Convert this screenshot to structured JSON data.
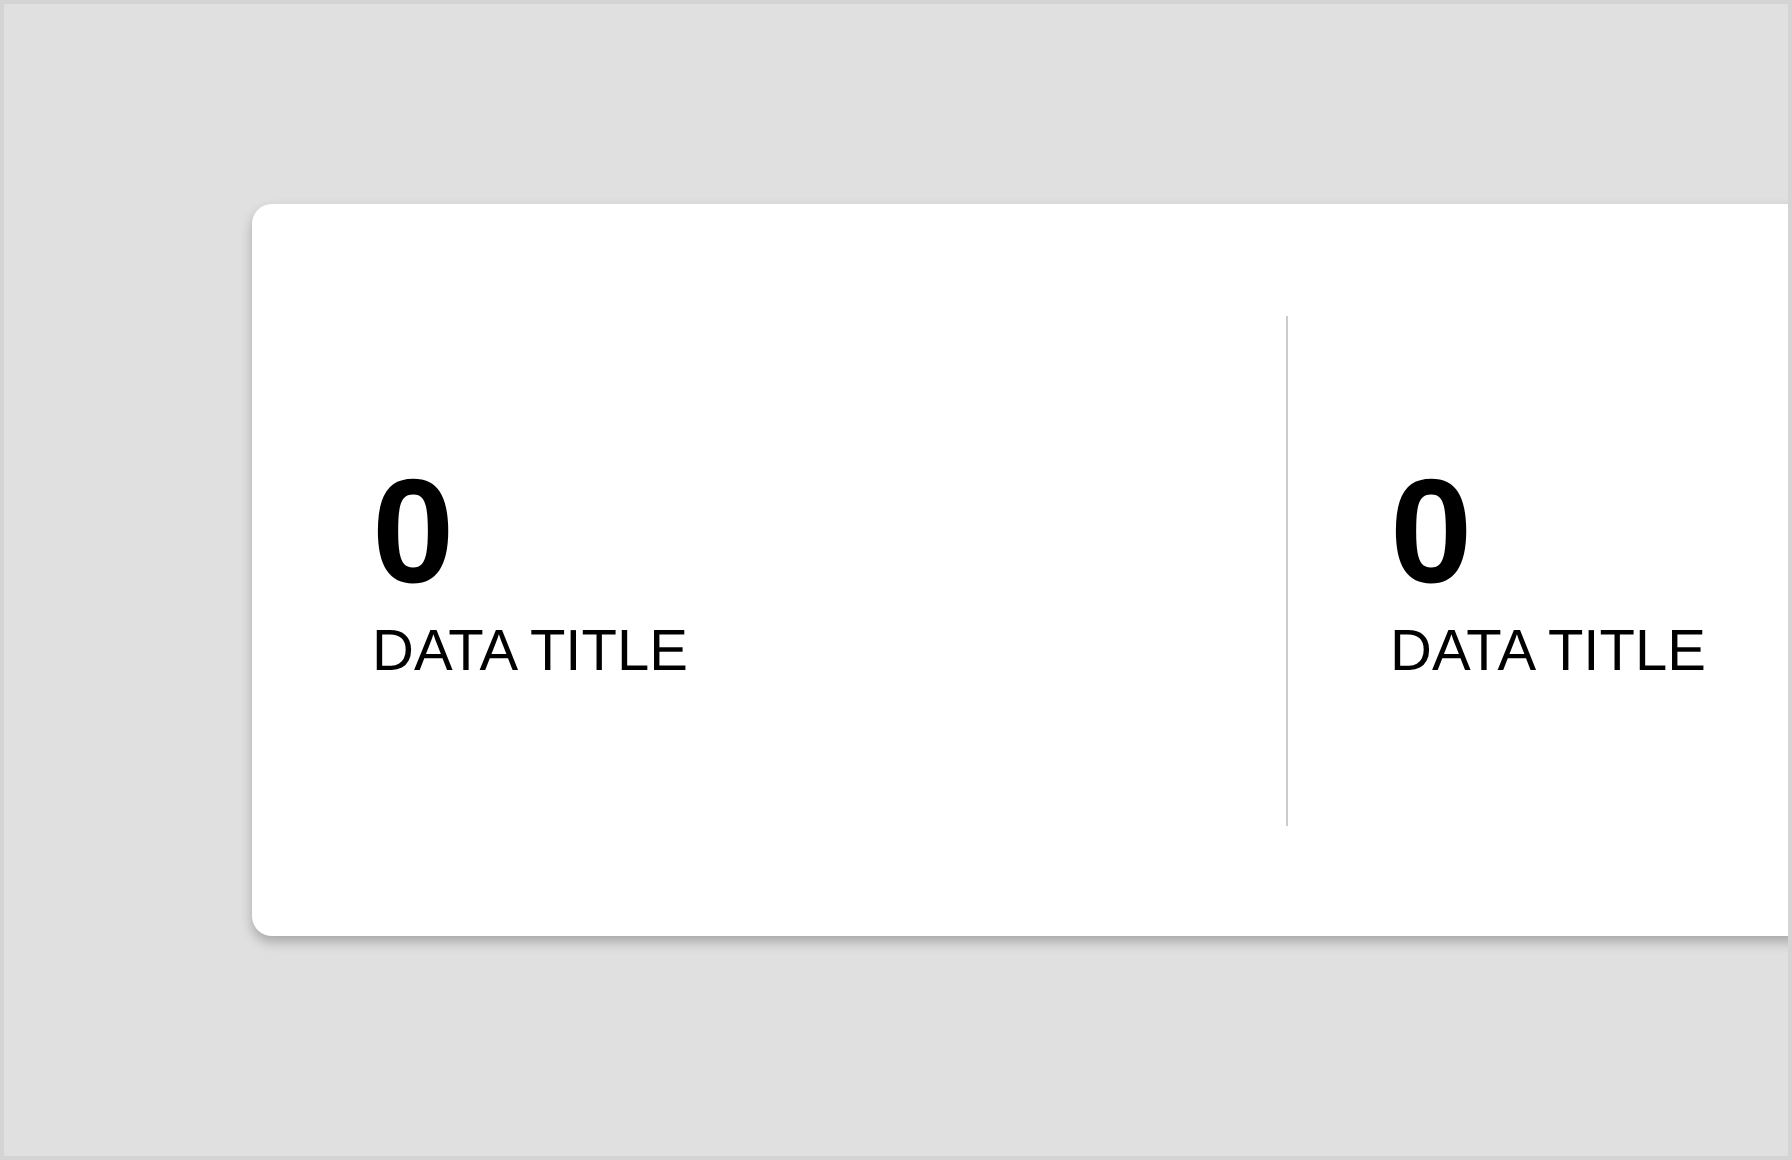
{
  "stats": [
    {
      "value": "0",
      "title": "DATA TITLE"
    },
    {
      "value": "0",
      "title": "DATA TITLE"
    }
  ]
}
